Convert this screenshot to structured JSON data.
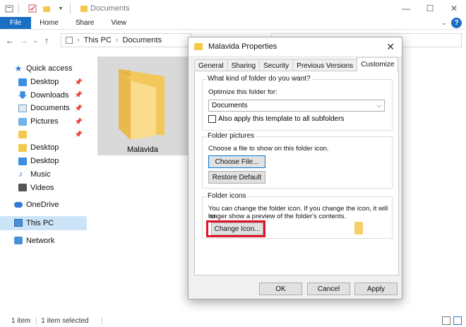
{
  "explorer": {
    "title": "Documents",
    "ribbon_tabs": [
      "File",
      "Home",
      "Share",
      "View"
    ],
    "breadcrumb": [
      "This PC",
      "Documents"
    ],
    "sidebar": {
      "quick_access": "Quick access",
      "items": [
        {
          "label": "Desktop",
          "icon": "desktop-icon",
          "pinned": true
        },
        {
          "label": "Downloads",
          "icon": "downloads-icon",
          "pinned": true
        },
        {
          "label": "Documents",
          "icon": "documents-icon",
          "pinned": true
        },
        {
          "label": "Pictures",
          "icon": "pictures-icon",
          "pinned": true
        },
        {
          "label": "",
          "icon": "folder-icon",
          "pinned": true
        },
        {
          "label": "Desktop",
          "icon": "folder-icon",
          "pinned": false
        },
        {
          "label": "Desktop",
          "icon": "desktop-icon",
          "pinned": false
        },
        {
          "label": "Music",
          "icon": "music-icon",
          "pinned": false
        },
        {
          "label": "Videos",
          "icon": "videos-icon",
          "pinned": false
        }
      ],
      "onedrive": "OneDrive",
      "this_pc": "This PC",
      "network": "Network"
    },
    "folder_name": "Malavida",
    "status_items": "1 item",
    "status_selected": "1 item selected"
  },
  "dialog": {
    "title": "Malavida Properties",
    "tabs": [
      "General",
      "Sharing",
      "Security",
      "Previous Versions",
      "Customize"
    ],
    "active_tab": "Customize",
    "folder_type": {
      "group_label": "What kind of folder do you want?",
      "optimize_label": "Optimize this folder for:",
      "selected": "Documents",
      "apply_subfolders": "Also apply this template to all subfolders"
    },
    "folder_pictures": {
      "group_label": "Folder pictures",
      "description": "Choose a file to show on this folder icon.",
      "choose_file": "Choose File...",
      "restore_default": "Restore Default"
    },
    "folder_icons": {
      "group_label": "Folder icons",
      "description_line1": "You can change the folder icon. If you change the icon, it will no",
      "description_line2": "longer show a preview of the folder's contents.",
      "change_icon": "Change Icon..."
    },
    "ok": "OK",
    "cancel": "Cancel",
    "apply": "Apply"
  },
  "colors": {
    "accent": "#1a6fc4",
    "highlight": "#e0152a",
    "selection": "#cce4f7",
    "folder": "#f4c84d"
  }
}
